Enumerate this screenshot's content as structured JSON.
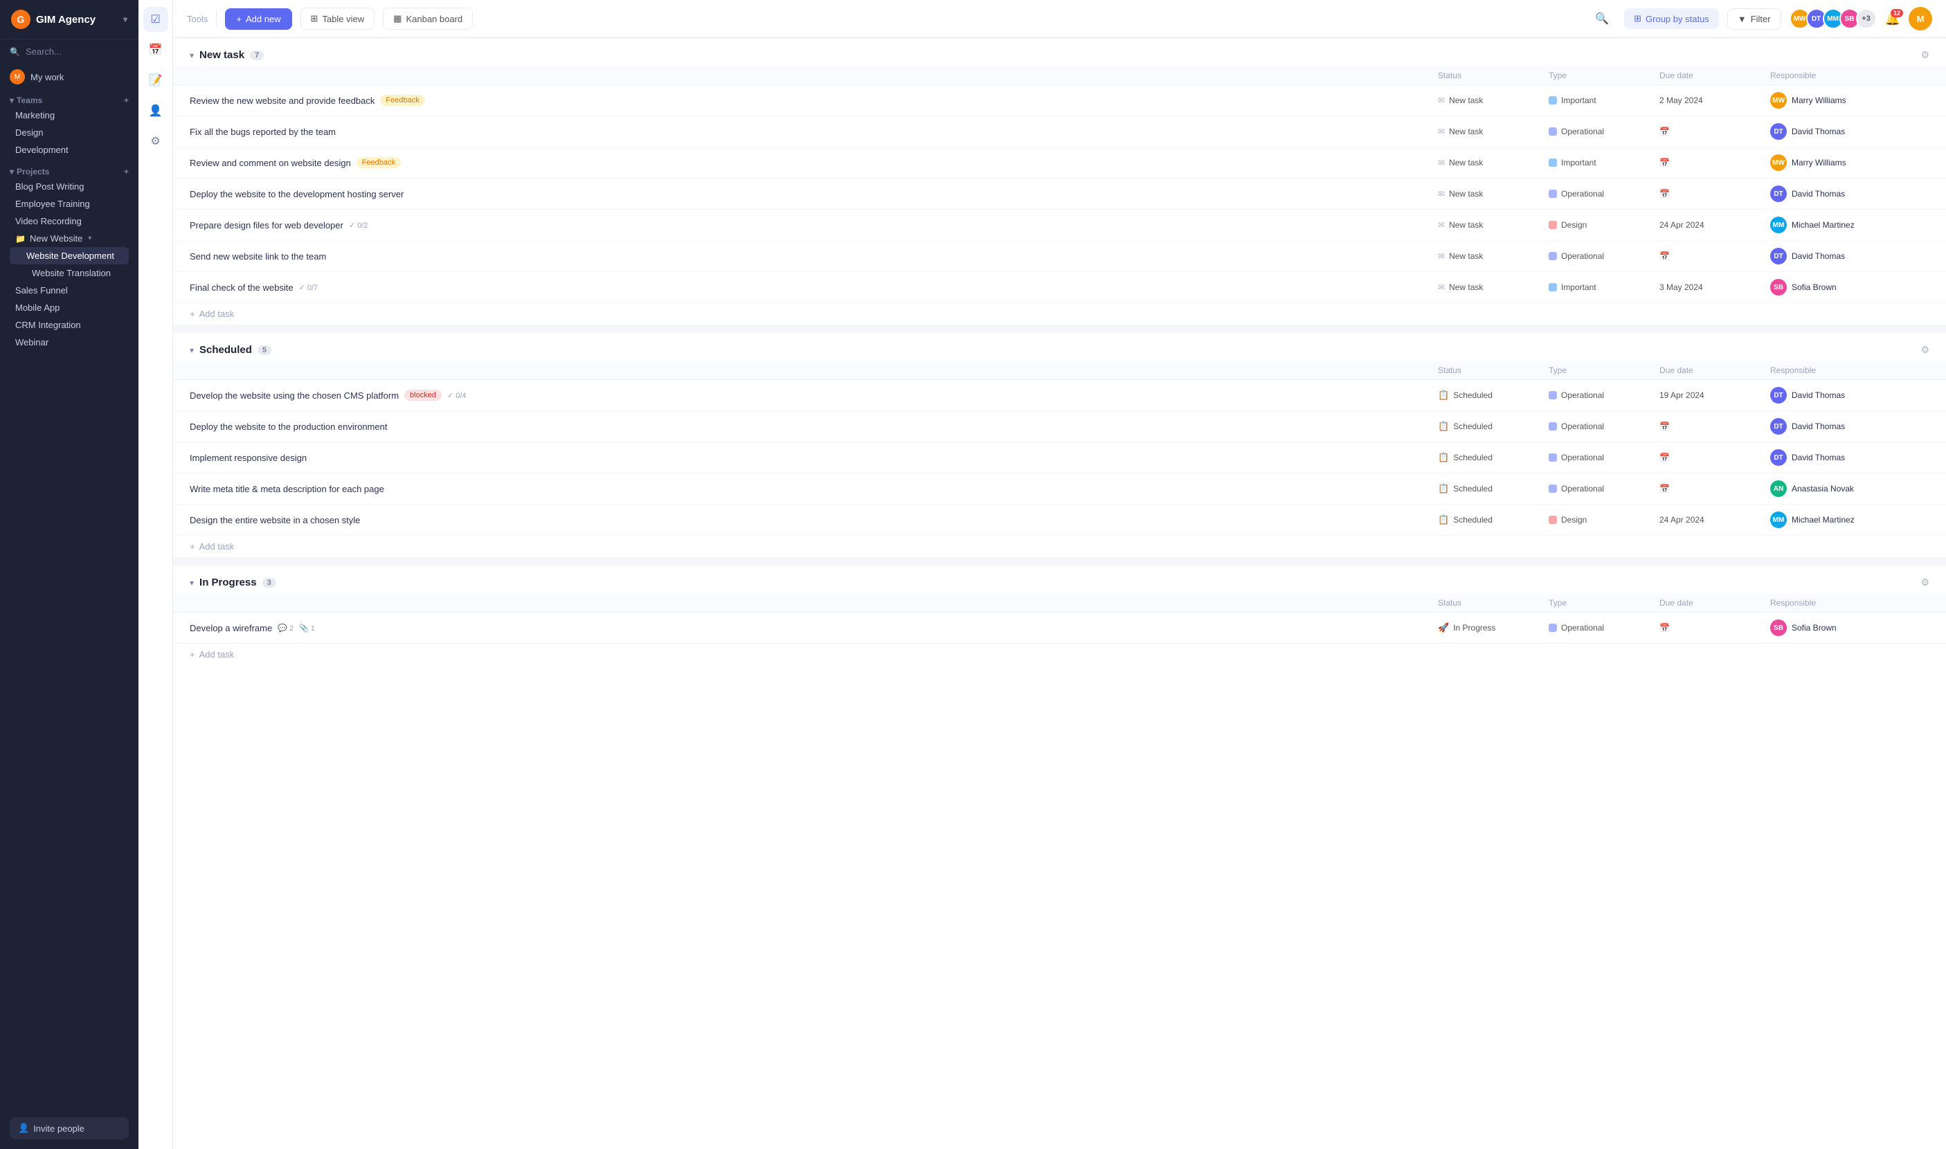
{
  "app": {
    "name": "GIM Agency",
    "logo_letter": "G"
  },
  "sidebar": {
    "search_placeholder": "Search...",
    "my_work": "My work",
    "teams_label": "Teams",
    "teams": [
      {
        "name": "Marketing"
      },
      {
        "name": "Design"
      },
      {
        "name": "Development"
      }
    ],
    "projects_label": "Projects",
    "projects": [
      {
        "name": "Blog Post Writing"
      },
      {
        "name": "Employee Training"
      },
      {
        "name": "Video Recording"
      },
      {
        "name": "New Website",
        "has_children": true
      },
      {
        "name": "Website Development",
        "active": true
      },
      {
        "name": "Website Translation",
        "sub": true
      },
      {
        "name": "Sales Funnel"
      },
      {
        "name": "Mobile App"
      },
      {
        "name": "CRM Integration"
      },
      {
        "name": "Webinar"
      }
    ],
    "invite_btn": "Invite people"
  },
  "toolbar": {
    "add_new": "+ Add new",
    "table_view": "Table view",
    "kanban_board": "Kanban board",
    "group_by_status": "Group by status",
    "filter": "Filter",
    "avatar_extra": "+3",
    "notif_count": "12"
  },
  "sections": [
    {
      "id": "new-task",
      "title": "New task",
      "count": "7",
      "col_headers": [
        "",
        "Status",
        "Type",
        "Due date",
        "Responsible",
        ""
      ],
      "tasks": [
        {
          "name": "Review the new website and provide feedback",
          "tag": "Feedback",
          "tag_class": "tag-feedback",
          "status": "New task",
          "status_icon": "envelope",
          "type": "Important",
          "type_class": "type-important",
          "due": "2 May 2024",
          "responsible": "Marry Williams",
          "resp_class": "av-marry",
          "resp_initials": "MW"
        },
        {
          "name": "Fix all the bugs reported by the team",
          "tag": "",
          "tag_class": "",
          "status": "New task",
          "status_icon": "envelope",
          "type": "Operational",
          "type_class": "type-operational",
          "due": "",
          "responsible": "David Thomas",
          "resp_class": "av-david",
          "resp_initials": "DT"
        },
        {
          "name": "Review and comment on website design",
          "tag": "Feedback",
          "tag_class": "tag-feedback",
          "status": "New task",
          "status_icon": "envelope",
          "type": "Important",
          "type_class": "type-important",
          "due": "",
          "responsible": "Marry Williams",
          "resp_class": "av-marry",
          "resp_initials": "MW"
        },
        {
          "name": "Deploy the website to the development hosting server",
          "tag": "",
          "tag_class": "",
          "status": "New task",
          "status_icon": "envelope",
          "type": "Operational",
          "type_class": "type-operational",
          "due": "",
          "responsible": "David Thomas",
          "resp_class": "av-david",
          "resp_initials": "DT"
        },
        {
          "name": "Prepare design files for web developer",
          "tag": "",
          "tag_class": "",
          "subtask": "✓ 0/2",
          "status": "New task",
          "status_icon": "envelope",
          "type": "Design",
          "type_class": "type-design",
          "due": "24 Apr 2024",
          "responsible": "Michael Martinez",
          "resp_class": "av-michael",
          "resp_initials": "MM"
        },
        {
          "name": "Send new website link to the team",
          "tag": "",
          "tag_class": "",
          "status": "New task",
          "status_icon": "envelope",
          "type": "Operational",
          "type_class": "type-operational",
          "due": "",
          "responsible": "David Thomas",
          "resp_class": "av-david",
          "resp_initials": "DT"
        },
        {
          "name": "Final check of the website",
          "tag": "",
          "tag_class": "",
          "subtask": "✓ 0/7",
          "status": "New task",
          "status_icon": "envelope",
          "type": "Important",
          "type_class": "type-important",
          "due": "3 May 2024",
          "responsible": "Sofia Brown",
          "resp_class": "av-sofia",
          "resp_initials": "SB"
        }
      ],
      "add_task": "+ Add task"
    },
    {
      "id": "scheduled",
      "title": "Scheduled",
      "count": "5",
      "col_headers": [
        "",
        "Status",
        "Type",
        "Due date",
        "Responsible",
        ""
      ],
      "tasks": [
        {
          "name": "Develop the website using the chosen CMS platform",
          "tag": "blocked",
          "tag_class": "tag-blocked",
          "subtask": "✓ 0/4",
          "status": "Scheduled",
          "status_icon": "calendar-check",
          "type": "Operational",
          "type_class": "type-operational",
          "due": "19 Apr 2024",
          "responsible": "David Thomas",
          "resp_class": "av-david",
          "resp_initials": "DT"
        },
        {
          "name": "Deploy the website to the production environment",
          "tag": "",
          "tag_class": "",
          "status": "Scheduled",
          "status_icon": "calendar-check",
          "type": "Operational",
          "type_class": "type-operational",
          "due": "",
          "responsible": "David Thomas",
          "resp_class": "av-david",
          "resp_initials": "DT"
        },
        {
          "name": "Implement responsive design",
          "tag": "",
          "tag_class": "",
          "status": "Scheduled",
          "status_icon": "calendar-check",
          "type": "Operational",
          "type_class": "type-operational",
          "due": "",
          "responsible": "David Thomas",
          "resp_class": "av-david",
          "resp_initials": "DT"
        },
        {
          "name": "Write meta title & meta description for each page",
          "tag": "",
          "tag_class": "",
          "status": "Scheduled",
          "status_icon": "calendar-check",
          "type": "Operational",
          "type_class": "type-operational",
          "due": "",
          "responsible": "Anastasia Novak",
          "resp_class": "av-anastasia",
          "resp_initials": "AN"
        },
        {
          "name": "Design the entire website in a chosen style",
          "tag": "",
          "tag_class": "",
          "status": "Scheduled",
          "status_icon": "calendar-check",
          "type": "Design",
          "type_class": "type-design",
          "due": "24 Apr 2024",
          "responsible": "Michael Martinez",
          "resp_class": "av-michael",
          "resp_initials": "MM"
        }
      ],
      "add_task": "+ Add task"
    },
    {
      "id": "in-progress",
      "title": "In Progress",
      "count": "3",
      "col_headers": [
        "",
        "Status",
        "Type",
        "Due date",
        "Responsible",
        ""
      ],
      "tasks": [
        {
          "name": "Develop a wireframe",
          "tag": "",
          "tag_class": "",
          "comments": "💬 2",
          "attachments": "📎 1",
          "status": "In Progress",
          "status_icon": "rocket",
          "type": "Operational",
          "type_class": "type-operational",
          "due": "",
          "responsible": "Sofia Brown",
          "resp_class": "av-sofia",
          "resp_initials": "SB"
        }
      ],
      "add_task": "+ Add task"
    }
  ]
}
